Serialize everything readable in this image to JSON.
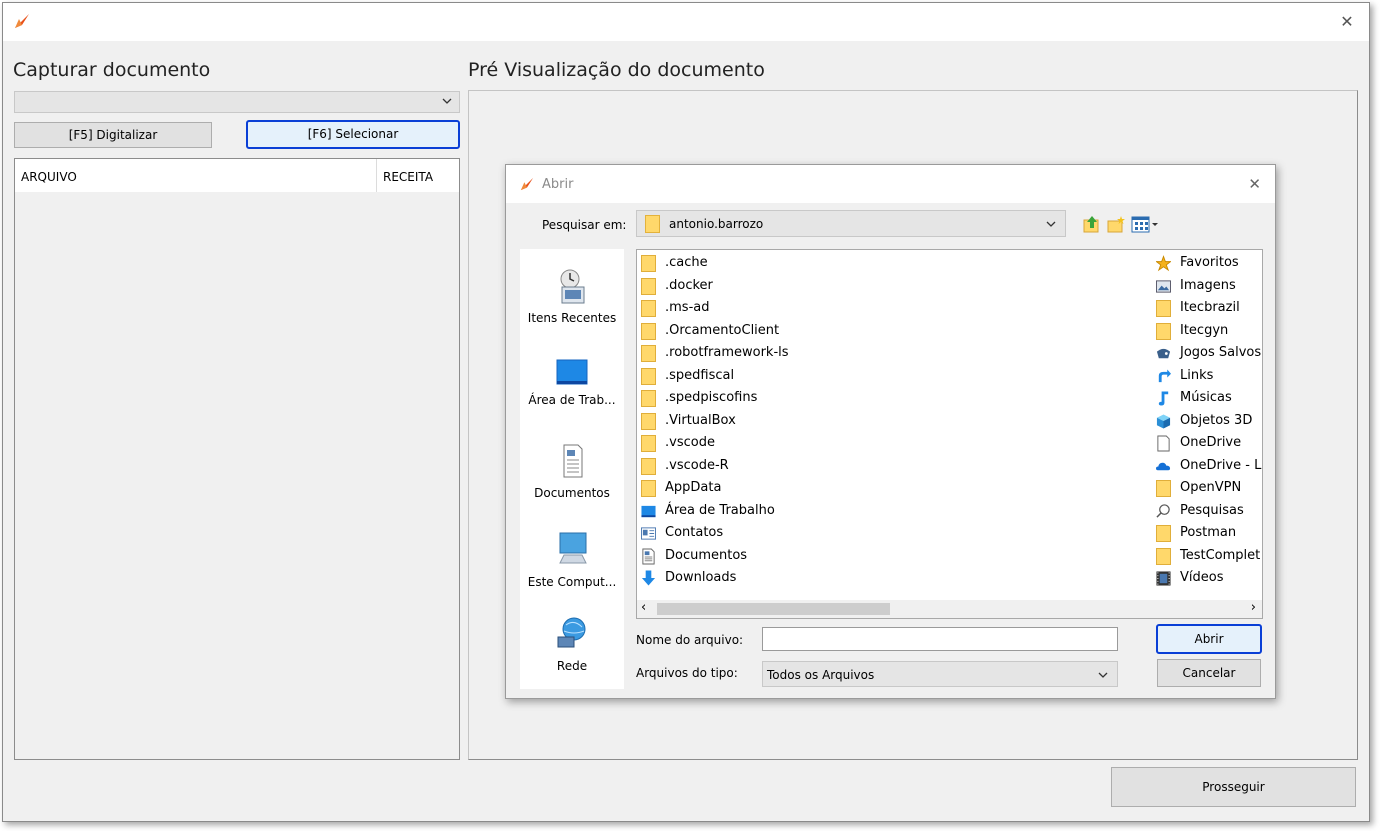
{
  "window": {
    "left_heading": "Capturar documento",
    "right_heading": "Pré Visualização do documento",
    "btn_digitalizar": "[F5] Digitalizar",
    "btn_selecionar": "[F6] Selecionar",
    "col_arquivo": "ARQUIVO",
    "col_receita": "RECEITA",
    "btn_prosseguir": "Prosseguir"
  },
  "dialog": {
    "title": "Abrir",
    "lookin_label": "Pesquisar em:",
    "lookin_value": "antonio.barrozo",
    "places": [
      "Itens Recentes",
      "Área de Trab...",
      "Documentos",
      "Este Comput...",
      "Rede"
    ],
    "files_left": [
      {
        "name": ".cache",
        "icon": "folder"
      },
      {
        "name": ".docker",
        "icon": "folder"
      },
      {
        "name": ".ms-ad",
        "icon": "folder"
      },
      {
        "name": ".OrcamentoClient",
        "icon": "folder"
      },
      {
        "name": ".robotframework-ls",
        "icon": "folder"
      },
      {
        "name": ".spedfiscal",
        "icon": "folder"
      },
      {
        "name": ".spedpiscofins",
        "icon": "folder"
      },
      {
        "name": ".VirtualBox",
        "icon": "folder"
      },
      {
        "name": ".vscode",
        "icon": "folder"
      },
      {
        "name": ".vscode-R",
        "icon": "folder"
      },
      {
        "name": "AppData",
        "icon": "folder"
      },
      {
        "name": "Área de Trabalho",
        "icon": "desktop"
      },
      {
        "name": "Contatos",
        "icon": "contacts"
      },
      {
        "name": "Documentos",
        "icon": "document"
      },
      {
        "name": "Downloads",
        "icon": "download"
      }
    ],
    "files_right": [
      {
        "name": "Favoritos",
        "icon": "star"
      },
      {
        "name": "Imagens",
        "icon": "image"
      },
      {
        "name": "Itecbrazil",
        "icon": "folder"
      },
      {
        "name": "Itecgyn",
        "icon": "folder"
      },
      {
        "name": "Jogos Salvos",
        "icon": "games"
      },
      {
        "name": "Links",
        "icon": "link"
      },
      {
        "name": "Músicas",
        "icon": "music"
      },
      {
        "name": "Objetos 3D",
        "icon": "cube"
      },
      {
        "name": "OneDrive",
        "icon": "file"
      },
      {
        "name": "OneDrive - L",
        "icon": "cloud"
      },
      {
        "name": "OpenVPN",
        "icon": "folder"
      },
      {
        "name": "Pesquisas",
        "icon": "search"
      },
      {
        "name": "Postman",
        "icon": "folder"
      },
      {
        "name": "TestComplet",
        "icon": "folder"
      },
      {
        "name": "Vídeos",
        "icon": "film"
      }
    ],
    "filename_label": "Nome do arquivo:",
    "filename_value": "",
    "filetype_label": "Arquivos do tipo:",
    "filetype_value": "Todos os Arquivos",
    "btn_abrir": "Abrir",
    "btn_cancelar": "Cancelar"
  },
  "colors": {
    "accent_focus": "#0a3fd6",
    "folder": "#ffd86b",
    "app_icon": "#e8501a"
  }
}
